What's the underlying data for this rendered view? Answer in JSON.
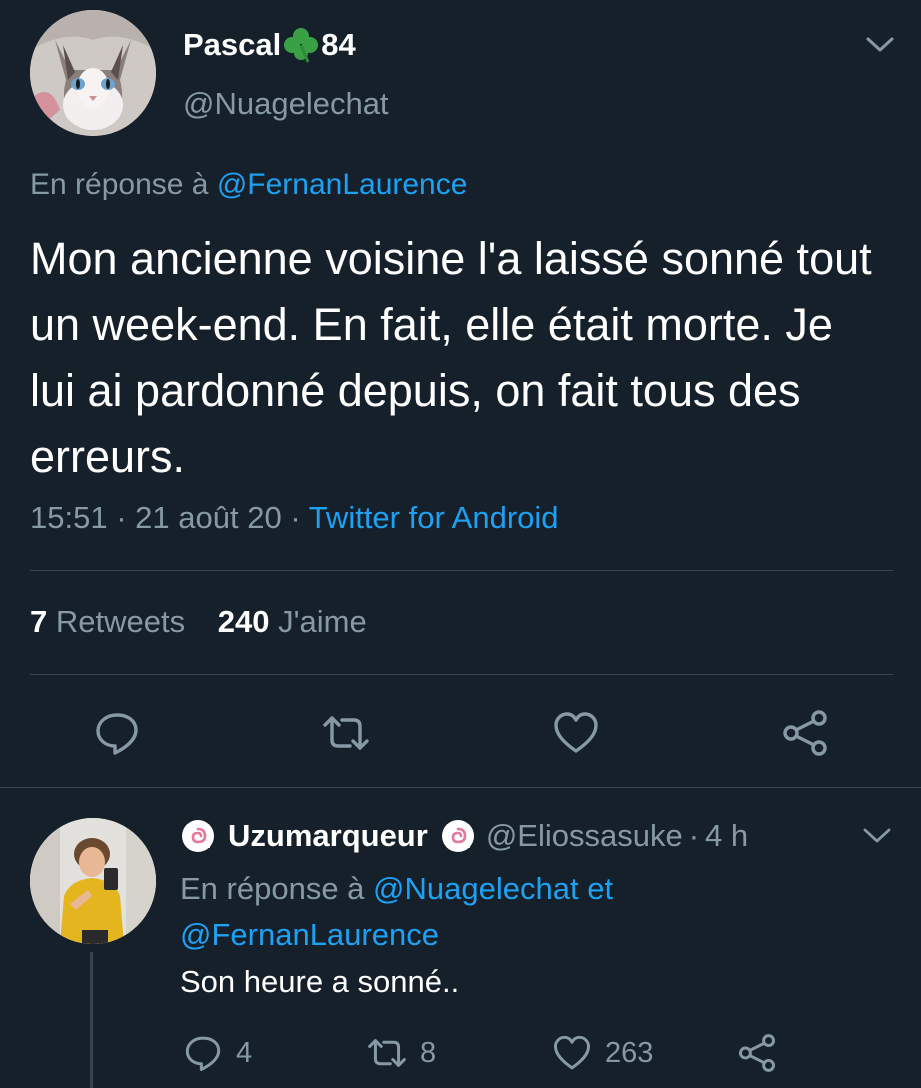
{
  "colors": {
    "background": "#15202b",
    "text": "#ffffff",
    "secondary": "#8899a6",
    "accent": "#1da1f2",
    "divider": "#38444d"
  },
  "main_tweet": {
    "display_name_part1": "Pascal",
    "display_name_part2": "84",
    "name_emoji": "shamrock-icon",
    "handle": "@Nuagelechat",
    "reply_prefix": "En réponse à",
    "reply_to": "@FernanLaurence",
    "text": "Mon ancienne voisine l'a laissé sonné tout un week-end. En fait, elle était morte. Je lui ai pardonné depuis, on fait tous des erreurs.",
    "time": "15:51",
    "date": "21 août 20",
    "sep": "·",
    "source": "Twitter for Android",
    "retweets_count": "7",
    "retweets_label": "Retweets",
    "likes_count": "240",
    "likes_label": "J'aime",
    "actions": [
      "reply-icon",
      "retweet-icon",
      "like-icon",
      "share-icon"
    ]
  },
  "reply_tweet": {
    "display_name": "Uzumarqueur",
    "name_badge_icon": "naruto-swirl-icon",
    "handle": "@Eliossasuke",
    "sep": "·",
    "time": "4 h",
    "reply_prefix": "En réponse à",
    "reply_to_1": "@Nuagelechat",
    "reply_conj": "et",
    "reply_to_2": "@FernanLaurence",
    "text": "Son heure a sonné..",
    "reply_count": "4",
    "retweet_count": "8",
    "like_count": "263"
  }
}
